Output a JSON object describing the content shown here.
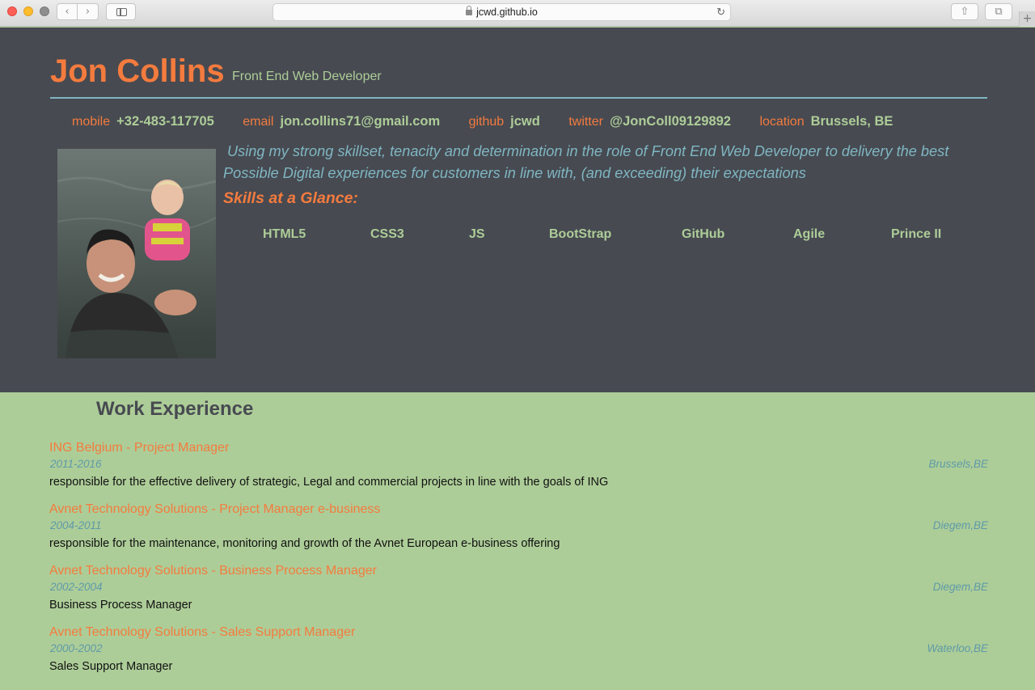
{
  "browser": {
    "url": "jcwd.github.io",
    "back_icon": "chevron-left",
    "forward_icon": "chevron-right",
    "reload_icon": "reload",
    "share_icon": "share",
    "tabs_icon": "tabs",
    "new_tab": "+"
  },
  "header": {
    "name": "Jon Collins",
    "role": "Front End Web Developer"
  },
  "contacts": [
    {
      "label": "mobile",
      "value": "+32-483-117705"
    },
    {
      "label": "email",
      "value": "jon.collins71@gmail.com"
    },
    {
      "label": "github",
      "value": "jcwd"
    },
    {
      "label": "twitter",
      "value": "@JonColl09129892"
    },
    {
      "label": "location",
      "value": "Brussels, BE"
    }
  ],
  "objective": "Using my strong skillset, tenacity and determination in the role of Front End Web Developer to delivery the best Possible Digital experiences for customers in line with, (and exceeding) their expectations",
  "skills": {
    "title": "Skills at a Glance:",
    "items": [
      "HTML5",
      "CSS3",
      "JS",
      "BootStrap",
      "GitHub",
      "Agile",
      "Prince II"
    ]
  },
  "work": {
    "title": "Work Experience",
    "jobs": [
      {
        "title": "ING Belgium - Project Manager",
        "dates": "2011-2016",
        "location": "Brussels,BE",
        "description": "responsible for the effective delivery of strategic, Legal and commercial projects in line with the goals of ING"
      },
      {
        "title": "Avnet Technology Solutions - Project Manager e-business",
        "dates": "2004-2011",
        "location": "Diegem,BE",
        "description": "responsible for the maintenance, monitoring and growth of the Avnet European e-business offering"
      },
      {
        "title": "Avnet Technology Solutions - Business Process Manager",
        "dates": "2002-2004",
        "location": "Diegem,BE",
        "description": "Business Process Manager"
      },
      {
        "title": "Avnet Technology Solutions - Sales Support Manager",
        "dates": "2000-2002",
        "location": "Waterloo,BE",
        "description": "Sales Support Manager"
      }
    ]
  },
  "colors": {
    "accent": "#f47b3e",
    "green": "#adcd98",
    "blue": "#7fb6c2",
    "dark": "#474a51"
  }
}
